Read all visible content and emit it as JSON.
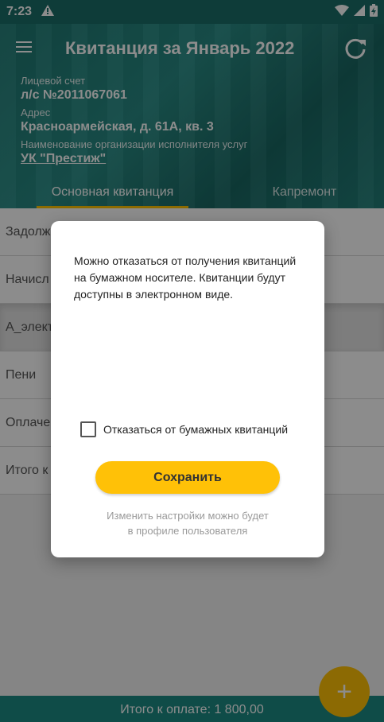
{
  "status_bar": {
    "time": "7:23"
  },
  "header": {
    "title": "Квитанция за Январь 2022",
    "account_label": "Лицевой счет",
    "account_value": "л/с №2011067061",
    "address_label": "Адрес",
    "address_value": "Красноармейская, д. 61А, кв. 3",
    "org_label": "Наименование организации исполнителя услуг",
    "org_value": "УК \"Престиж\""
  },
  "tabs": [
    {
      "label": "Основная квитанция",
      "active": true
    },
    {
      "label": "Капремонт",
      "active": false
    }
  ],
  "rows": [
    {
      "label": "Задолж"
    },
    {
      "label": "Начисл"
    },
    {
      "label": "А_элект"
    },
    {
      "label": "Пени"
    },
    {
      "label": "Оплаче"
    },
    {
      "label": "Итого к"
    }
  ],
  "bottom_bar": {
    "total_label": "Итого к оплате: 1 800,00"
  },
  "fab": {
    "icon": "plus-icon",
    "label": "+"
  },
  "dialog": {
    "message": "Можно отказаться от получения квитанций на бумажном носителе. Квитанции будут доступны в электронном виде.",
    "checkbox_label": "Отказаться от бумажных квитанций",
    "checkbox_checked": false,
    "save_label": "Сохранить",
    "note_line1": "Изменить настройки можно будет",
    "note_line2": "в профиле пользователя"
  },
  "colors": {
    "primary": "#1f7c76",
    "accent": "#ffc107",
    "tab_indicator": "#ffc400"
  }
}
